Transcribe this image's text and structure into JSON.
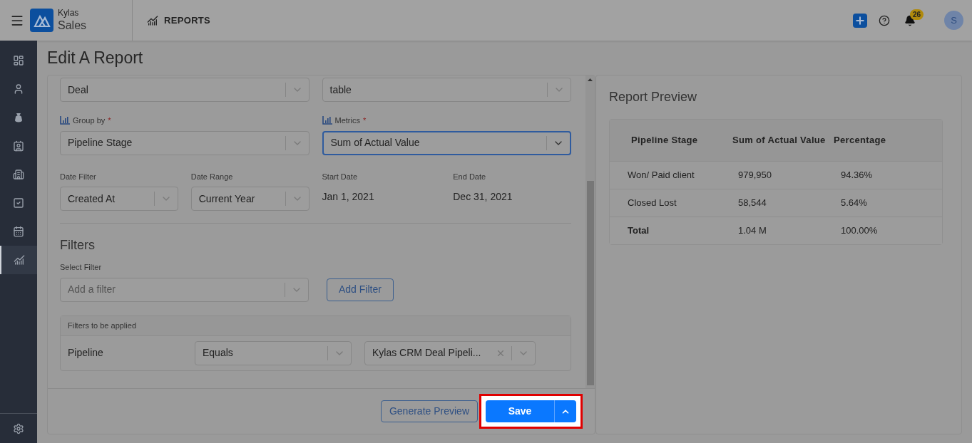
{
  "header": {
    "brand_top": "Kylas",
    "brand_bottom": "Sales",
    "section": "REPORTS",
    "notification_count": "26",
    "avatar_letter": "S"
  },
  "sidebar": {
    "items": [
      {
        "kind": "dashboard",
        "selected": false
      },
      {
        "kind": "person",
        "selected": false
      },
      {
        "kind": "moneybag",
        "selected": false
      },
      {
        "kind": "contact",
        "selected": false
      },
      {
        "kind": "building",
        "selected": false
      },
      {
        "kind": "task",
        "selected": false
      },
      {
        "kind": "calendar",
        "selected": false
      },
      {
        "kind": "reports",
        "selected": true
      }
    ]
  },
  "page_title": "Edit A Report",
  "form": {
    "entity": {
      "value": "Deal"
    },
    "report_type": {
      "value": "table"
    },
    "group_by": {
      "label": "Group by",
      "required_mark": "*",
      "value": "Pipeline Stage",
      "focused": false
    },
    "metrics": {
      "label": "Metrics",
      "required_mark": "*",
      "value": "Sum of Actual Value",
      "focused": true
    },
    "date_filter": {
      "label": "Date Filter",
      "value": "Created At"
    },
    "date_range": {
      "label": "Date Range",
      "value": "Current Year"
    },
    "start_date": {
      "label": "Start Date",
      "value": "Jan 1, 2021"
    },
    "end_date": {
      "label": "End Date",
      "value": "Dec 31, 2021"
    },
    "filters": {
      "heading": "Filters",
      "select_label": "Select Filter",
      "placeholder": "Add a filter",
      "add_button": "Add Filter",
      "applied_heading": "Filters to be applied",
      "applied": [
        {
          "field": "Pipeline",
          "operator": "Equals",
          "value": "Kylas CRM Deal Pipeli..."
        }
      ]
    },
    "buttons": {
      "preview": "Generate Preview",
      "save": "Save"
    }
  },
  "preview": {
    "title": "Report Preview",
    "columns": [
      "Pipeline Stage",
      "Sum of Actual Value",
      "Percentage"
    ],
    "rows": [
      {
        "cells": [
          "Won/ Paid client",
          "979,950",
          "94.36%"
        ],
        "total": false
      },
      {
        "cells": [
          "Closed Lost",
          "58,544",
          "5.64%"
        ],
        "total": false
      },
      {
        "cells": [
          "Total",
          "1.04 M",
          "100.00%"
        ],
        "total": true
      }
    ]
  }
}
